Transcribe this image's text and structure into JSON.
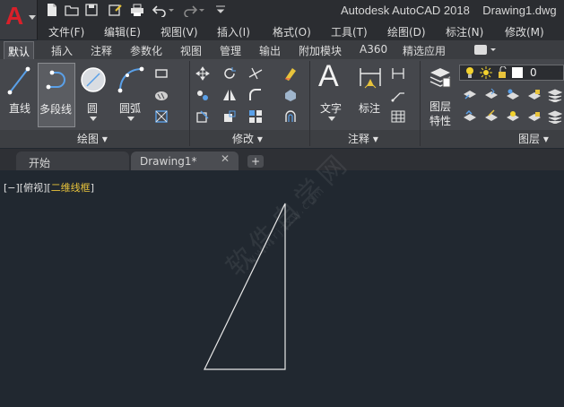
{
  "app": {
    "title": "Autodesk AutoCAD 2018",
    "filename": "Drawing1.dwg",
    "logo_letter": "A",
    "logo_color": "#d9202a"
  },
  "quick_access": [
    "new-icon",
    "open-icon",
    "save-icon",
    "save-as-icon",
    "print-icon",
    "undo-icon",
    "redo-icon",
    "customize-icon"
  ],
  "menu": {
    "items": [
      "文件(F)",
      "编辑(E)",
      "视图(V)",
      "插入(I)",
      "格式(O)",
      "工具(T)",
      "绘图(D)",
      "标注(N)",
      "修改(M)"
    ]
  },
  "ribbon_tabs": {
    "items": [
      "默认",
      "插入",
      "注释",
      "参数化",
      "视图",
      "管理",
      "输出",
      "附加模块",
      "A360",
      "精选应用"
    ],
    "active": "默认"
  },
  "draw_panel": {
    "title": "绘图 ▾",
    "line_label": "直线",
    "polyline_label": "多段线",
    "circle_label": "圆",
    "arc_label": "圆弧"
  },
  "modify_panel": {
    "title": "修改 ▾"
  },
  "annotation_panel": {
    "title": "注释 ▾",
    "text_label": "文字",
    "dimension_label": "标注"
  },
  "layers_panel": {
    "title": "图层 ▾",
    "properties_label_1": "图层",
    "properties_label_2": "特性",
    "current_layer": "0"
  },
  "file_tabs": {
    "start_label": "开始",
    "drawing_label": "Drawing1*",
    "close_glyph": "✕",
    "add_glyph": "+"
  },
  "viewport": {
    "controls_prefix": "[−][俯视][",
    "visual_style": "二维线框",
    "controls_suffix": "]"
  },
  "watermark": {
    "text": "软件自学网",
    "url": "www.rjzxw.com"
  },
  "drawing": {
    "entity": "triangle",
    "color": "#e8e8e8"
  }
}
